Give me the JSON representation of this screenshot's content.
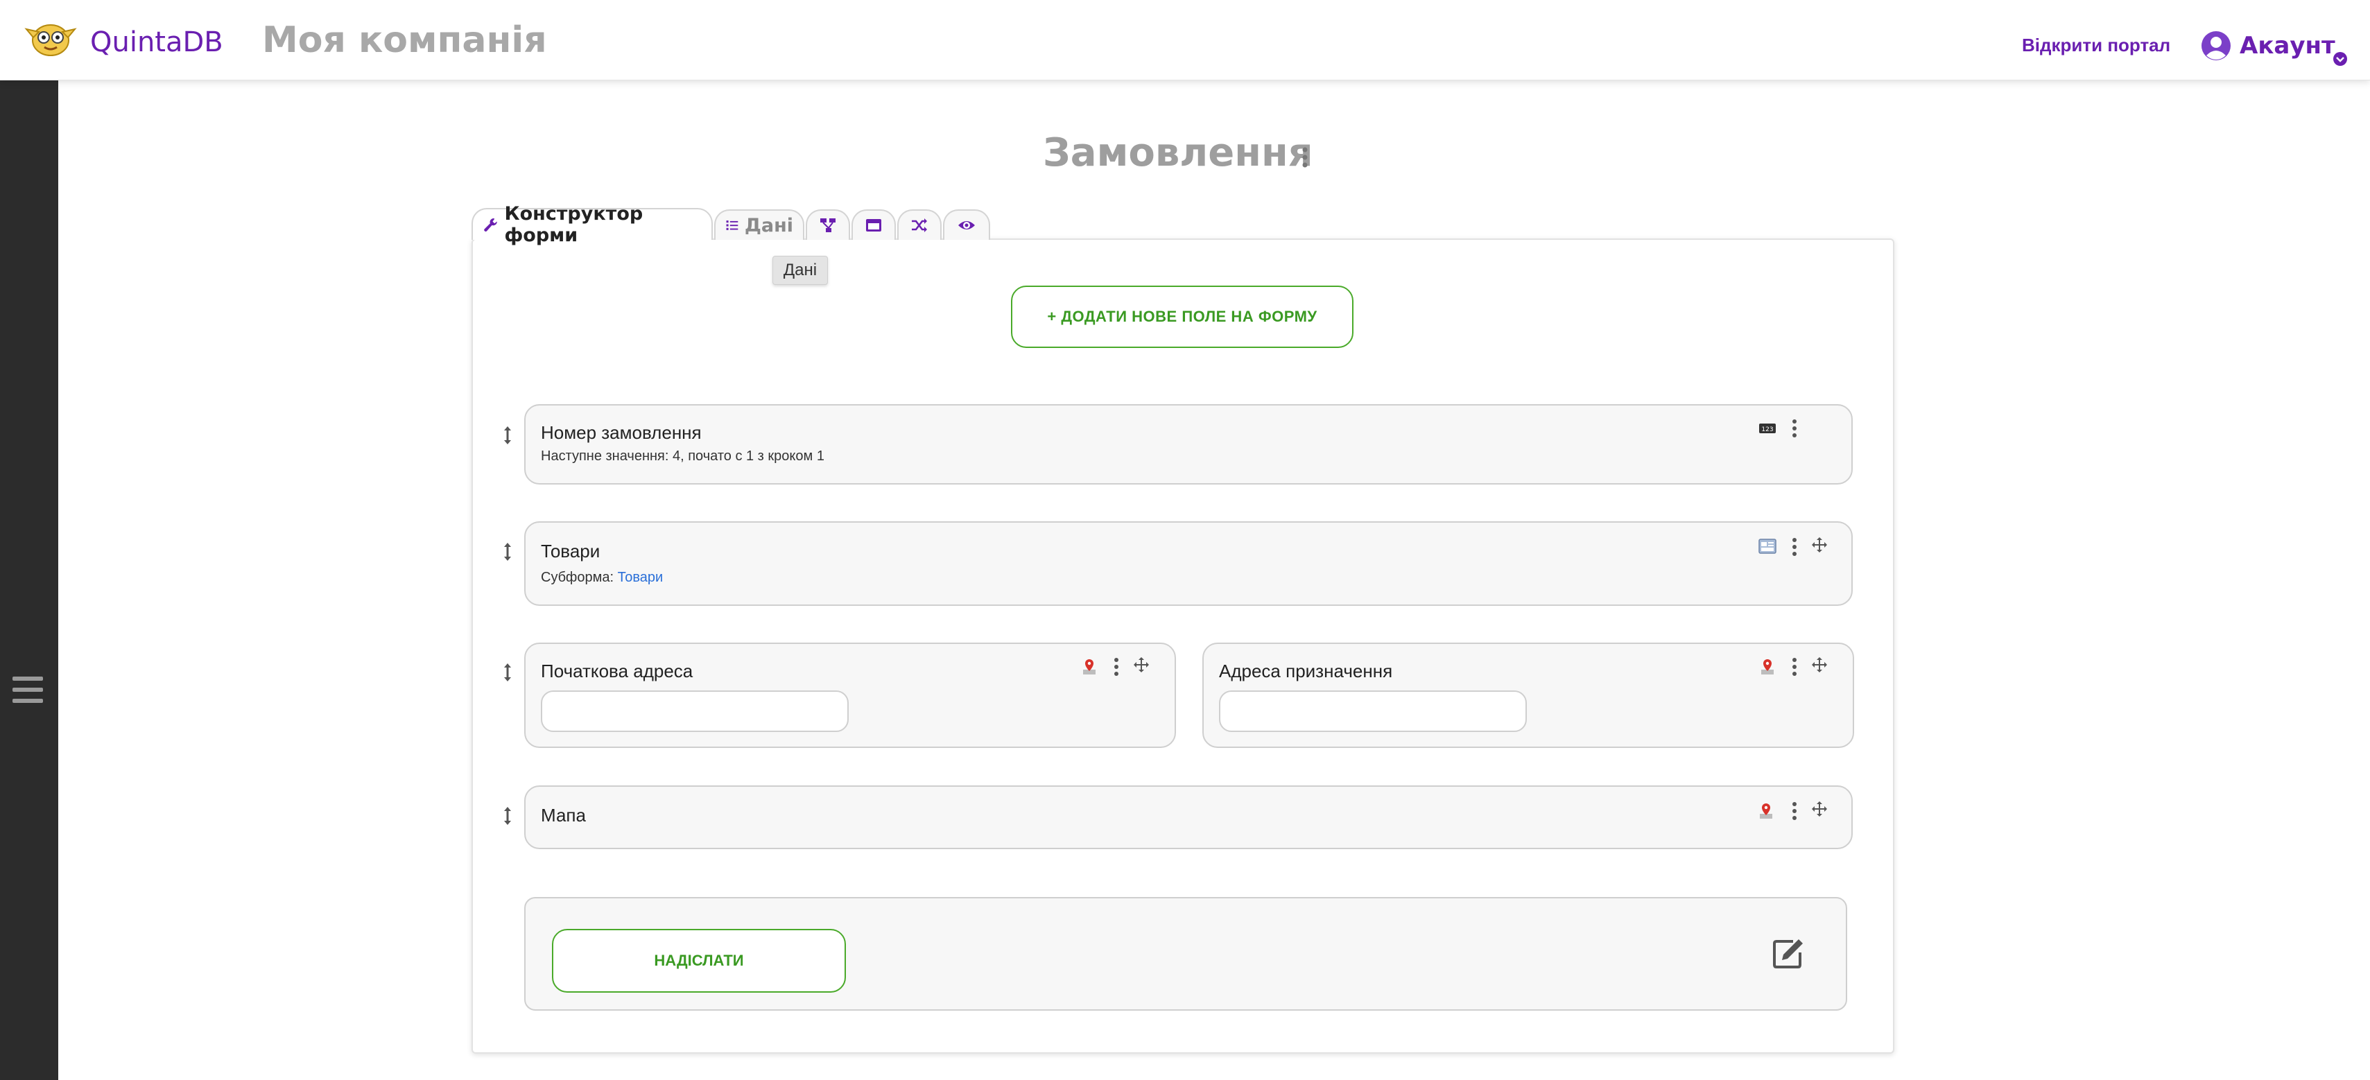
{
  "header": {
    "brand": "QuintaDB",
    "company": "Моя компанія",
    "portal_link": "Відкрити портал",
    "account_label": "Акаунт"
  },
  "page": {
    "title": "Замовлення"
  },
  "tabs": [
    {
      "label": "Конструктор форми",
      "icon": "wrench-icon",
      "active": true
    },
    {
      "label": "Дані",
      "icon": "list-icon"
    },
    {
      "label": "",
      "icon": "sitemap-icon"
    },
    {
      "label": "",
      "icon": "window-icon"
    },
    {
      "label": "",
      "icon": "shuffle-icon"
    },
    {
      "label": "",
      "icon": "eye-icon"
    }
  ],
  "tooltip": "Дані",
  "add_field_button": "+ ДОДАТИ НОВЕ ПОЛЕ НА ФОРМУ",
  "fields": {
    "order_number": {
      "label": "Номер замовлення",
      "sub": "Наступне значення: 4, почато с 1 з кроком 1",
      "type_icon": "counter-icon"
    },
    "products": {
      "label": "Товари",
      "sub_prefix": "Субформа:",
      "sub_link": "Товари",
      "type_icon": "subform-icon"
    },
    "start_address": {
      "label": "Початкова адреса",
      "value": "",
      "type_icon": "map-pin-icon"
    },
    "destination_address": {
      "label": "Адреса призначення",
      "value": "",
      "type_icon": "map-pin-icon"
    },
    "map": {
      "label": "Мапа",
      "type_icon": "map-pin-icon"
    }
  },
  "submit_button": "НАДІСЛАТИ",
  "colors": {
    "brand": "#6a1fb0",
    "accent_green": "#3a9a22",
    "sidebar": "#2c2c2c",
    "link_blue": "#2a6fd8"
  }
}
